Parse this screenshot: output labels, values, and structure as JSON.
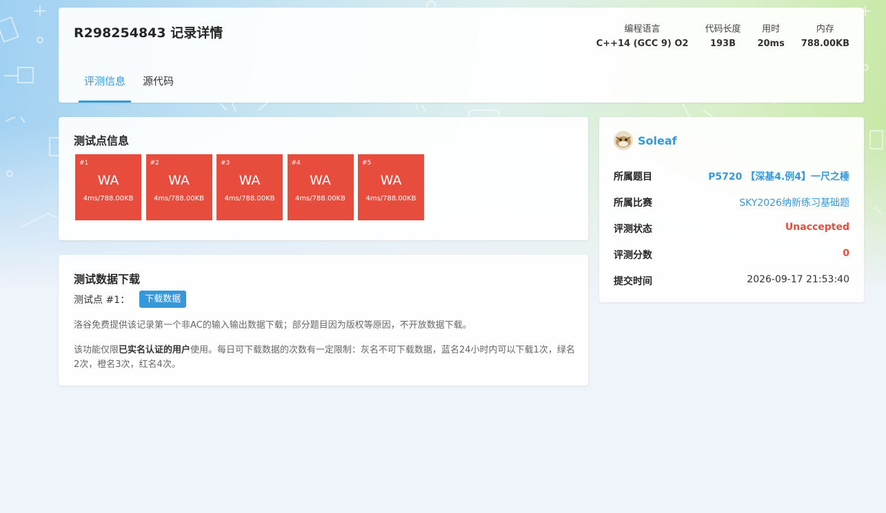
{
  "record": {
    "title": "R298254843 记录详情",
    "stats": [
      {
        "label": "编程语言",
        "value": "C++14 (GCC 9) O2"
      },
      {
        "label": "代码长度",
        "value": "193B"
      },
      {
        "label": "用时",
        "value": "20ms"
      },
      {
        "label": "内存",
        "value": "788.00KB"
      }
    ],
    "tabs": [
      {
        "label": "评测信息",
        "active": true
      },
      {
        "label": "源代码",
        "active": false
      }
    ]
  },
  "testpoints": {
    "title": "测试点信息",
    "items": [
      {
        "id": "#1",
        "status": "WA",
        "info": "4ms/788.00KB"
      },
      {
        "id": "#2",
        "status": "WA",
        "info": "4ms/788.00KB"
      },
      {
        "id": "#3",
        "status": "WA",
        "info": "4ms/788.00KB"
      },
      {
        "id": "#4",
        "status": "WA",
        "info": "4ms/788.00KB"
      },
      {
        "id": "#5",
        "status": "WA",
        "info": "4ms/788.00KB"
      }
    ],
    "status_color": "#e74c3c"
  },
  "download": {
    "title": "测试数据下载",
    "label": "测试点 #1：",
    "button": "下载数据",
    "note1": "洛谷免费提供该记录第一个非AC的输入输出数据下载；部分题目因为版权等原因，不开放数据下载。",
    "note2_prefix": "该功能仅限",
    "note2_bold": "已实名认证的用户",
    "note2_suffix": "使用。每日可下载数据的次数有一定限制：灰名不可下载数据，蓝名24小时内可以下载1次，绿名2次，橙名3次，红名4次。"
  },
  "info": {
    "username": "Soleaf",
    "rows": [
      {
        "label": "所属题目",
        "value": "P5720 【深基4.例4】一尺之棰"
      },
      {
        "label": "所属比赛",
        "value": "SKY2026纳新练习基础题"
      },
      {
        "label": "评测状态",
        "value": "Unaccepted"
      },
      {
        "label": "评测分数",
        "value": "0"
      },
      {
        "label": "提交时间",
        "value": "2026-09-17 21:53:40"
      }
    ]
  },
  "colors": {
    "accent": "#3498db",
    "error": "#e74c3c"
  }
}
